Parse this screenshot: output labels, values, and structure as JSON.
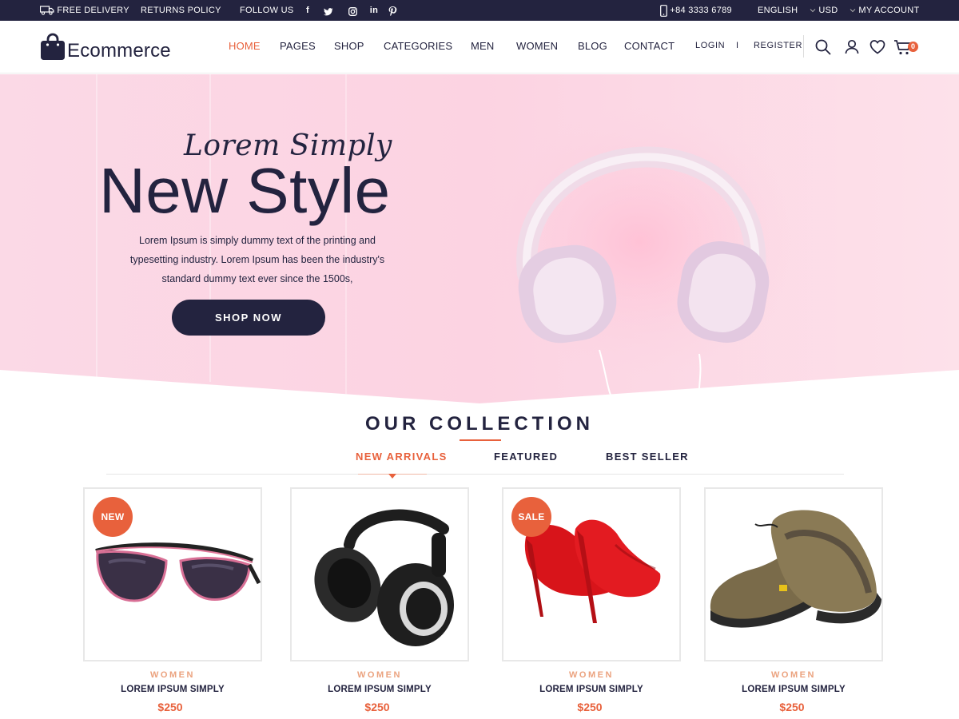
{
  "topbar": {
    "free_delivery": "FREE DELIVERY",
    "returns_policy": "RETURNS POLICY",
    "follow_us": "FOLLOW US",
    "social": [
      {
        "name": "facebook-icon",
        "glyph": "f"
      },
      {
        "name": "twitter-icon",
        "glyph": "t"
      },
      {
        "name": "instagram-icon",
        "glyph": "ig"
      },
      {
        "name": "linkedin-icon",
        "glyph": "in"
      },
      {
        "name": "pinterest-icon",
        "glyph": "p"
      }
    ],
    "phone": "+84 3333 6789",
    "language": "ENGLISH",
    "currency": "USD",
    "account": "MY ACCOUNT"
  },
  "header": {
    "logo_text": "Ecommerce",
    "nav": [
      "HOME",
      "PAGES",
      "SHOP",
      "CATEGORIES",
      "MEN",
      "WOMEN",
      "BLOG",
      "CONTACT"
    ],
    "active_nav": "HOME",
    "login": "LOGIN",
    "separator": "I",
    "register": "REGISTER",
    "cart_count": "0"
  },
  "hero": {
    "script_title": "Lorem Simply",
    "title": "New Style",
    "description": "Lorem Ipsum is simply dummy text of the printing and typesetting industry. Lorem Ipsum has been the industry's standard dummy text ever since the 1500s,",
    "button": "SHOP NOW"
  },
  "collection": {
    "title": "OUR COLLECTION",
    "tabs": [
      "NEW ARRIVALS",
      "FEATURED",
      "BEST SELLER"
    ],
    "active_tab": "NEW ARRIVALS",
    "products": [
      {
        "badge": "NEW",
        "category": "WOMEN",
        "name": "LOREM IPSUM SIMPLY",
        "price": "$250",
        "image": "sunglasses"
      },
      {
        "badge": "",
        "category": "WOMEN",
        "name": "LOREM IPSUM SIMPLY",
        "price": "$250",
        "image": "headphones"
      },
      {
        "badge": "SALE",
        "category": "WOMEN",
        "name": "LOREM IPSUM SIMPLY",
        "price": "$250",
        "image": "red-heels"
      },
      {
        "badge": "",
        "category": "WOMEN",
        "name": "LOREM IPSUM SIMPLY",
        "price": "$250",
        "image": "hiking-shoes"
      }
    ]
  },
  "colors": {
    "navy": "#23233f",
    "accent": "#e8613c",
    "hero_pink": "#fcd6e4"
  }
}
